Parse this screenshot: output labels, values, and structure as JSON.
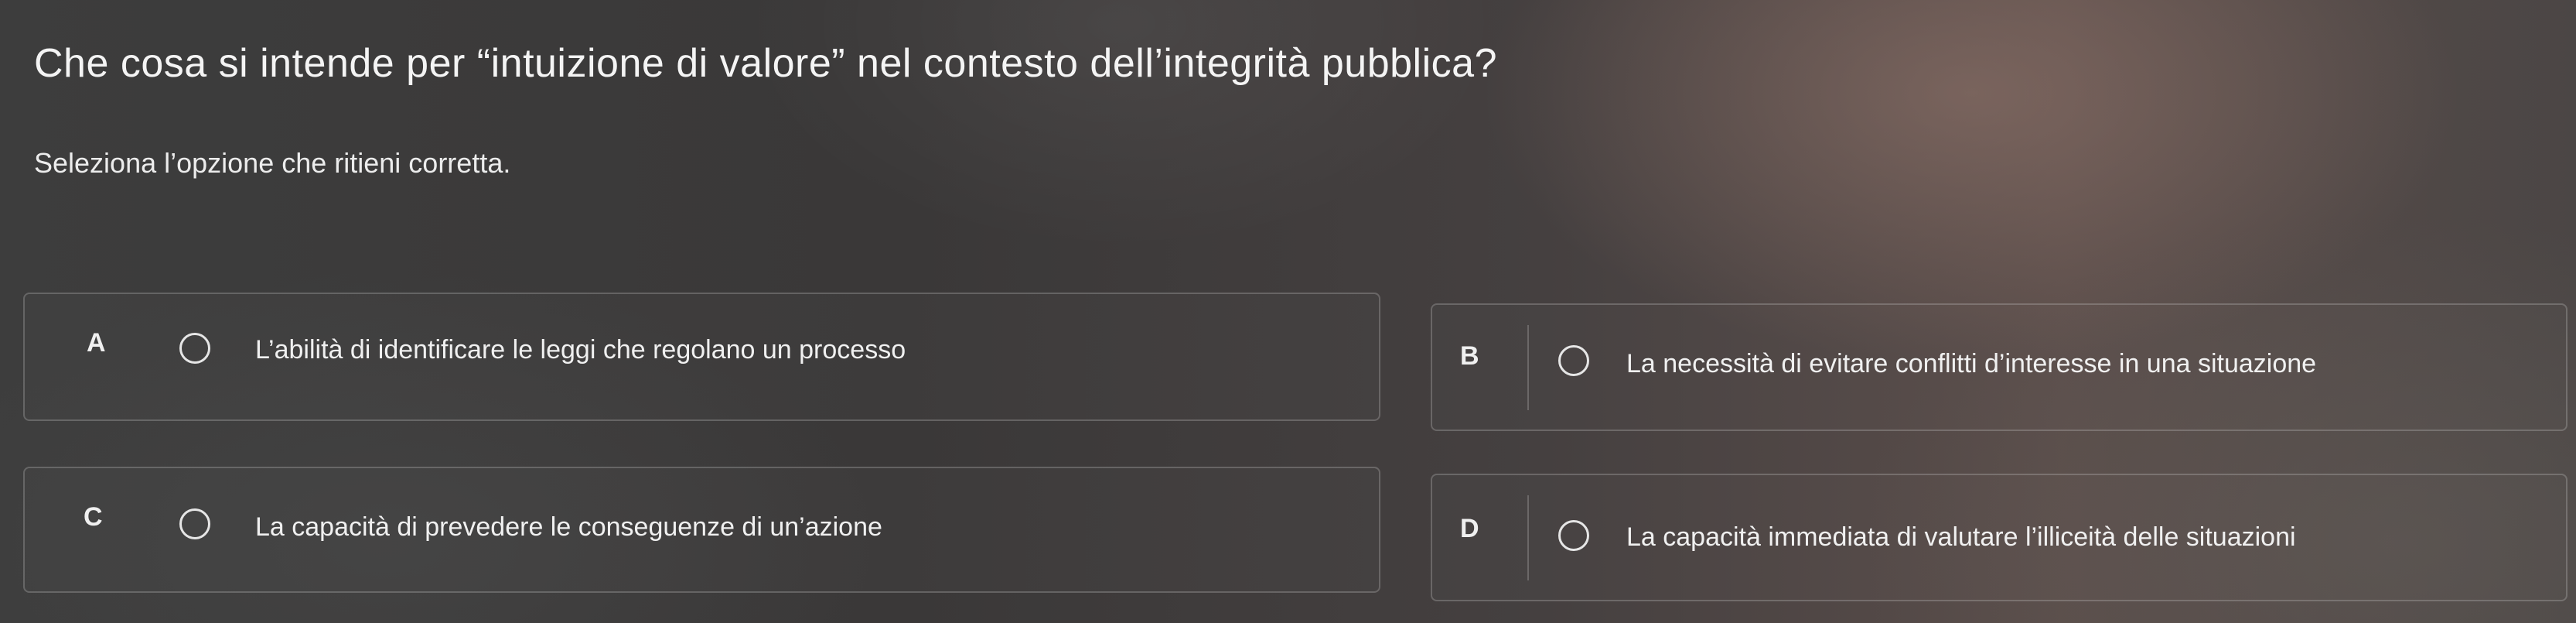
{
  "question": {
    "title": "Che cosa si intende per “intuizione di valore” nel contesto dell’integrità pubblica?",
    "instruction": "Seleziona l’opzione che ritieni corretta."
  },
  "options": [
    {
      "letter": "A",
      "text": "L’abilità di identificare le leggi che regolano un processo",
      "selected": false
    },
    {
      "letter": "B",
      "text": "La necessità di evitare conflitti d’interesse in una situazione",
      "selected": false
    },
    {
      "letter": "C",
      "text": "La capacità di prevedere le conseguenze di un’azione",
      "selected": false
    },
    {
      "letter": "D",
      "text": "La capacità immediata di valutare l’illiceità delle situazioni",
      "selected": false
    }
  ]
}
